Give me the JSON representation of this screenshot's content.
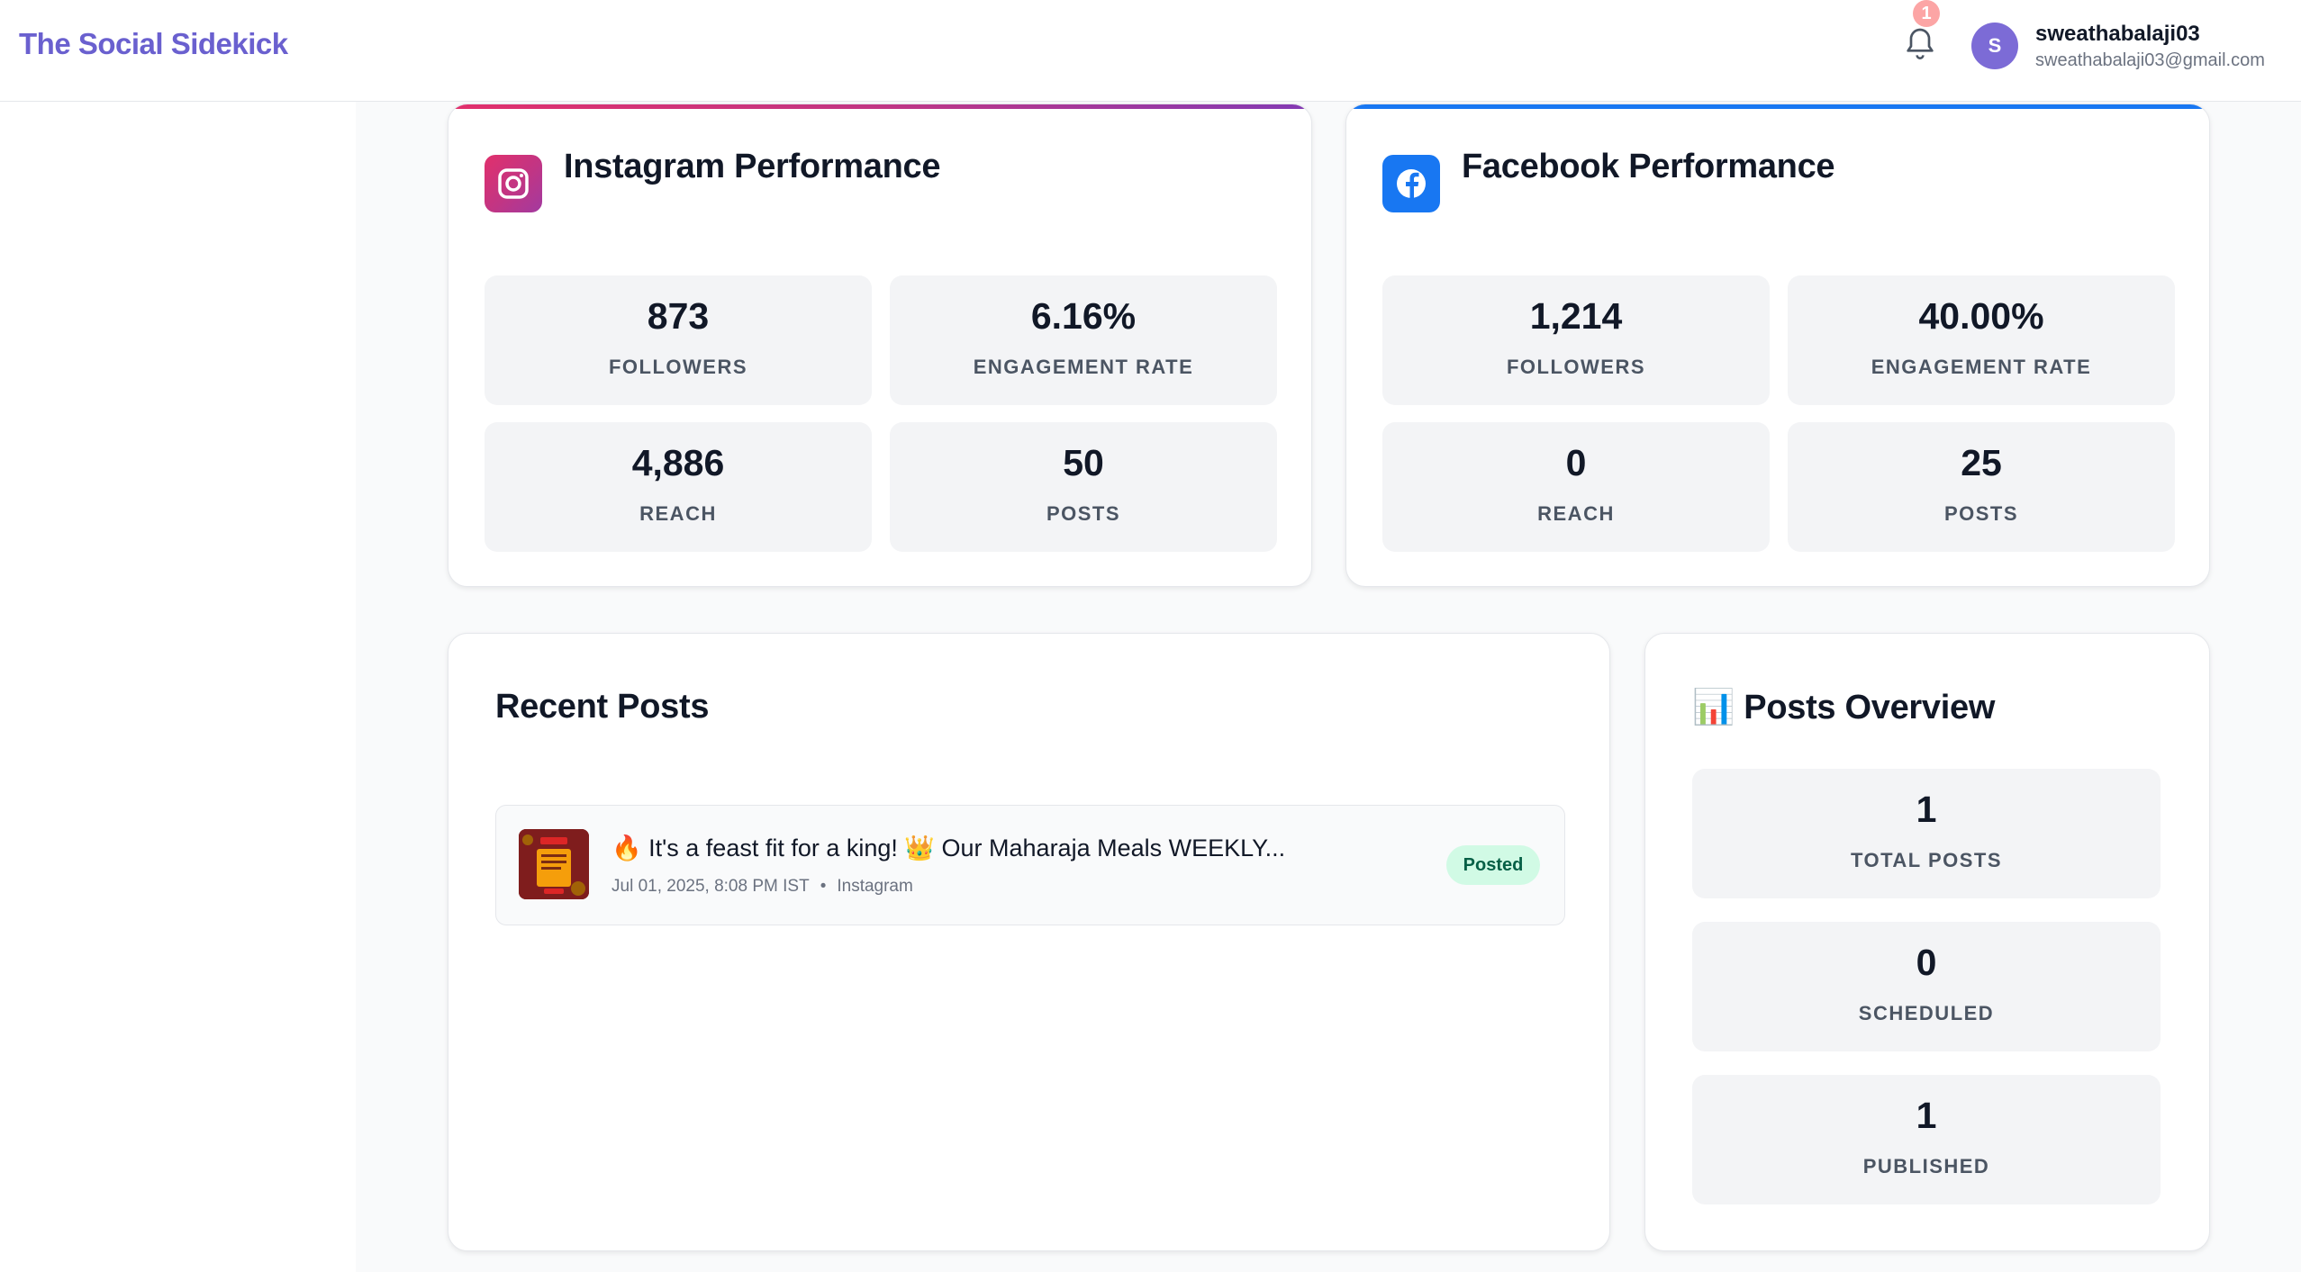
{
  "app": {
    "brand": "The Social Sidekick"
  },
  "header": {
    "notification_count": "1",
    "user": {
      "initial": "S",
      "name": "sweathabalaji03",
      "email": "sweathabalaji03@gmail.com"
    }
  },
  "instagram": {
    "title": "Instagram Performance",
    "stats": [
      {
        "value": "873",
        "label": "FOLLOWERS"
      },
      {
        "value": "6.16%",
        "label": "ENGAGEMENT RATE"
      },
      {
        "value": "4,886",
        "label": "REACH"
      },
      {
        "value": "50",
        "label": "POSTS"
      }
    ]
  },
  "facebook": {
    "title": "Facebook Performance",
    "stats": [
      {
        "value": "1,214",
        "label": "FOLLOWERS"
      },
      {
        "value": "40.00%",
        "label": "ENGAGEMENT RATE"
      },
      {
        "value": "0",
        "label": "REACH"
      },
      {
        "value": "25",
        "label": "POSTS"
      }
    ]
  },
  "recent_posts": {
    "title": "Recent Posts",
    "items": [
      {
        "text": "🔥 It's a feast fit for a king! 👑 Our Maharaja Meals WEEKLY...",
        "date": "Jul 01, 2025, 8:08 PM IST",
        "separator": "•",
        "platform": "Instagram",
        "status": "Posted"
      }
    ]
  },
  "overview": {
    "title": "📊 Posts Overview",
    "stats": [
      {
        "value": "1",
        "label": "TOTAL POSTS"
      },
      {
        "value": "0",
        "label": "SCHEDULED"
      },
      {
        "value": "1",
        "label": "PUBLISHED"
      }
    ]
  },
  "colors": {
    "brand": "#6a60cf",
    "instagram_gradient": [
      "#e1306c",
      "#c13584",
      "#833ab4"
    ],
    "facebook_blue": "#1877f2",
    "posted_badge_bg": "#d1fae5",
    "posted_badge_text": "#065f46"
  },
  "icons": {
    "bell": "bell-icon",
    "instagram": "instagram-icon",
    "facebook": "facebook-icon"
  }
}
